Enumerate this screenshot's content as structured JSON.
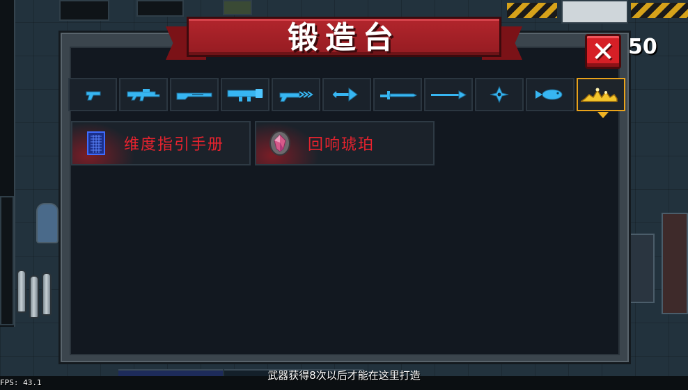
{
  "window": {
    "title": "锻造台",
    "close_label": "✕",
    "currency_count": "50"
  },
  "tabs": [
    {
      "icon": "pistol-icon",
      "active": false
    },
    {
      "icon": "assault-rifle-icon",
      "active": false
    },
    {
      "icon": "shotgun-icon",
      "active": false
    },
    {
      "icon": "rocket-launcher-icon",
      "active": false
    },
    {
      "icon": "laser-gun-icon",
      "active": false
    },
    {
      "icon": "bow-icon",
      "active": false
    },
    {
      "icon": "sword-icon",
      "active": false
    },
    {
      "icon": "spear-icon",
      "active": false
    },
    {
      "icon": "shuriken-icon",
      "active": false
    },
    {
      "icon": "fish-icon",
      "active": false
    },
    {
      "icon": "crown-materials-icon",
      "active": true
    }
  ],
  "items": [
    {
      "label": "维度指引手册",
      "icon": "dimension-manual-icon"
    },
    {
      "label": "回响琥珀",
      "icon": "echo-amber-icon"
    }
  ],
  "hint": "武器获得8次以后才能在这里打造",
  "fps": "FPS: 43.1",
  "colors": {
    "accent_red": "#e8232e",
    "tab_icon_blue": "#37b6f2",
    "active_tab_gold": "#e8a21b"
  }
}
